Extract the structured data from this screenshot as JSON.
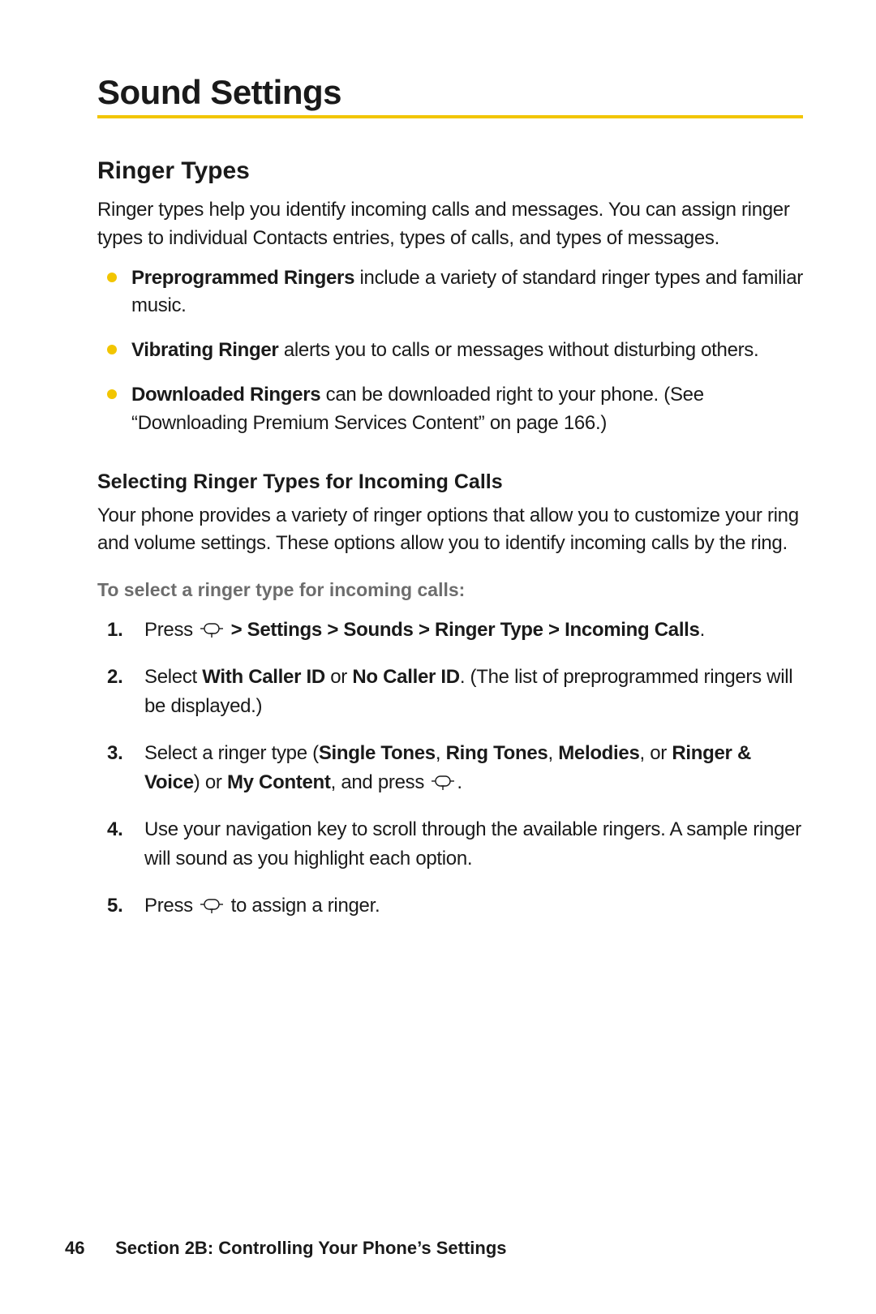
{
  "heading": "Sound Settings",
  "section": {
    "title": "Ringer Types",
    "intro": "Ringer types help you identify incoming calls and messages. You can assign ringer types to individual Contacts entries, types of calls, and types of messages.",
    "bullets": [
      {
        "strong": "Preprogrammed Ringers",
        "rest": " include a variety of standard ringer types and familiar music."
      },
      {
        "strong": "Vibrating Ringer",
        "rest": " alerts you to calls or messages without disturbing others."
      },
      {
        "strong": "Downloaded Ringers",
        "rest": " can be downloaded right to your phone. (See “Downloading Premium Services Content” on page 166.)"
      }
    ],
    "subhead": "Selecting Ringer Types for Incoming Calls",
    "subintro": "Your phone provides a variety of ringer options that allow you to customize your ring and volume settings. These options allow you to identify incoming calls by the ring.",
    "leadin": "To select a ringer type for incoming calls:",
    "steps": {
      "s1_pre": "Press ",
      "s1_bold": " > Settings > Sounds > Ringer Type > Incoming Calls",
      "s1_post": ".",
      "s2_pre": "Select ",
      "s2_bold_a": "With Caller ID",
      "s2_mid": " or ",
      "s2_bold_b": "No Caller ID",
      "s2_post": ". (The list of preprogrammed ringers will be displayed.)",
      "s3_pre": "Select a ringer type (",
      "s3_bold_a": "Single Tones",
      "s3_sep1": ", ",
      "s3_bold_b": "Ring Tones",
      "s3_sep2": ", ",
      "s3_bold_c": "Melodies",
      "s3_sep3": ", or ",
      "s3_bold_d": "Ringer & Voice",
      "s3_mid": ") or ",
      "s3_bold_e": "My Content",
      "s3_post1": ", and press ",
      "s3_post2": ".",
      "s4": " Use your navigation key to scroll through the available ringers. A sample ringer will sound as you highlight each option.",
      "s5_pre": "Press ",
      "s5_post": " to assign a ringer."
    }
  },
  "footer": {
    "page": "46",
    "section_label": "Section 2B: Controlling Your Phone’s Settings"
  }
}
